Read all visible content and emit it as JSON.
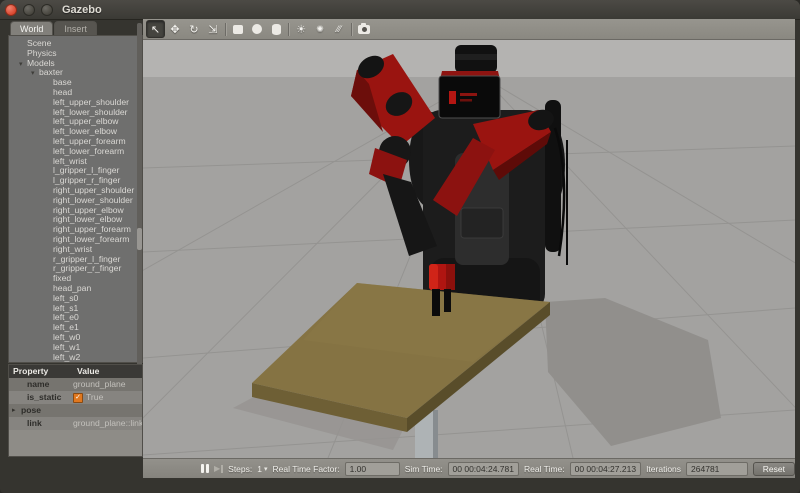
{
  "window": {
    "title": "Gazebo"
  },
  "tabs": {
    "world": "World",
    "insert": "Insert"
  },
  "tree": {
    "items": [
      {
        "arrow": "",
        "label": "Scene",
        "indent": 10
      },
      {
        "arrow": "",
        "label": "Physics",
        "indent": 10
      },
      {
        "arrow": "▾",
        "label": "Models",
        "indent": 10
      },
      {
        "arrow": "▾",
        "label": "baxter",
        "indent": 22
      },
      {
        "arrow": "",
        "label": "base",
        "indent": 36
      },
      {
        "arrow": "",
        "label": "head",
        "indent": 36
      },
      {
        "arrow": "",
        "label": "left_upper_shoulder",
        "indent": 36
      },
      {
        "arrow": "",
        "label": "left_lower_shoulder",
        "indent": 36
      },
      {
        "arrow": "",
        "label": "left_upper_elbow",
        "indent": 36
      },
      {
        "arrow": "",
        "label": "left_lower_elbow",
        "indent": 36
      },
      {
        "arrow": "",
        "label": "left_upper_forearm",
        "indent": 36
      },
      {
        "arrow": "",
        "label": "left_lower_forearm",
        "indent": 36
      },
      {
        "arrow": "",
        "label": "left_wrist",
        "indent": 36
      },
      {
        "arrow": "",
        "label": "l_gripper_l_finger",
        "indent": 36
      },
      {
        "arrow": "",
        "label": "l_gripper_r_finger",
        "indent": 36
      },
      {
        "arrow": "",
        "label": "right_upper_shoulder",
        "indent": 36
      },
      {
        "arrow": "",
        "label": "right_lower_shoulder",
        "indent": 36
      },
      {
        "arrow": "",
        "label": "right_upper_elbow",
        "indent": 36
      },
      {
        "arrow": "",
        "label": "right_lower_elbow",
        "indent": 36
      },
      {
        "arrow": "",
        "label": "right_upper_forearm",
        "indent": 36
      },
      {
        "arrow": "",
        "label": "right_lower_forearm",
        "indent": 36
      },
      {
        "arrow": "",
        "label": "right_wrist",
        "indent": 36
      },
      {
        "arrow": "",
        "label": "r_gripper_l_finger",
        "indent": 36
      },
      {
        "arrow": "",
        "label": "r_gripper_r_finger",
        "indent": 36
      },
      {
        "arrow": "",
        "label": "fixed",
        "indent": 36
      },
      {
        "arrow": "",
        "label": "head_pan",
        "indent": 36
      },
      {
        "arrow": "",
        "label": "left_s0",
        "indent": 36
      },
      {
        "arrow": "",
        "label": "left_s1",
        "indent": 36
      },
      {
        "arrow": "",
        "label": "left_e0",
        "indent": 36
      },
      {
        "arrow": "",
        "label": "left_e1",
        "indent": 36
      },
      {
        "arrow": "",
        "label": "left_w0",
        "indent": 36
      },
      {
        "arrow": "",
        "label": "left_w1",
        "indent": 36
      },
      {
        "arrow": "",
        "label": "left_w2",
        "indent": 36
      }
    ]
  },
  "properties": {
    "header": {
      "property": "Property",
      "value": "Value"
    },
    "rows": [
      {
        "key": "name",
        "arrow": "",
        "value": "ground_plane",
        "checkbox": false
      },
      {
        "key": "is_static",
        "arrow": "",
        "value": "True",
        "checkbox": true
      },
      {
        "key": "pose",
        "arrow": "▸",
        "value": "",
        "checkbox": false
      },
      {
        "key": "link",
        "arrow": "",
        "value": "ground_plane::link",
        "checkbox": false
      }
    ]
  },
  "toolbar": {
    "glyphs": {
      "select": "↖",
      "translate": "✥",
      "rotate": "↻",
      "scale": "⇲",
      "point_light": "☀",
      "spot_light": "✺",
      "directional_light": "⁄⁄⁄"
    }
  },
  "statusbar": {
    "steps_label": "Steps:",
    "steps_value": "1",
    "rtf_label": "Real Time Factor:",
    "rtf_value": "1.00",
    "sim_label": "Sim Time:",
    "sim_value": "00 00:04:24.781",
    "real_label": "Real Time:",
    "real_value": "00 00:04:27.213",
    "iter_label": "Iterations",
    "iter_value": "264781",
    "reset_label": "Reset"
  },
  "colors": {
    "robot_red": "#9a1410",
    "robot_black": "#161616",
    "table_top": "#857343",
    "sky": "#b4b3b1",
    "ground": "#a3a2a0",
    "checkbox_orange": "#e0781f",
    "close_button": "#d9472f"
  }
}
